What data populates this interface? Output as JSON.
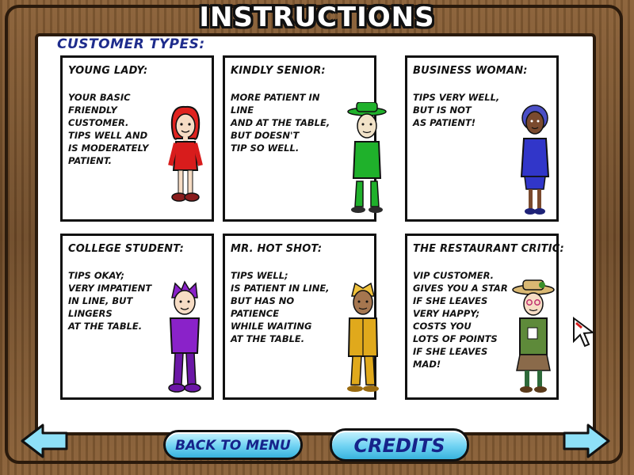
{
  "header": {
    "title": "INSTRUCTIONS"
  },
  "section": {
    "heading": "CUSTOMER TYPES:"
  },
  "customers": [
    {
      "title": "YOUNG LADY:",
      "description": "YOUR BASIC FRIENDLY\nCUSTOMER.\nTIPS WELL AND\nIS MODERATELY\nPATIENT.",
      "color": "#d81c1c"
    },
    {
      "title": "KINDLY SENIOR:",
      "description": "MORE PATIENT IN LINE\nAND AT THE TABLE,\nBUT DOESN'T\nTIP SO WELL.",
      "color": "#1fb12b"
    },
    {
      "title": "BUSINESS WOMAN:",
      "description": "TIPS VERY WELL,\nBUT IS NOT\nAS PATIENT!",
      "color": "#3136c9"
    },
    {
      "title": "COLLEGE STUDENT:",
      "description": "TIPS OKAY;\nVERY IMPATIENT\nIN LINE, BUT\nLINGERS\nAT THE TABLE.",
      "color": "#8a22c9"
    },
    {
      "title": "MR. HOT SHOT:",
      "description": "TIPS WELL;\nIS PATIENT IN LINE,\nBUT HAS NO PATIENCE\nWHILE WAITING\nAT THE TABLE.",
      "color": "#e0a91c"
    },
    {
      "title": "THE RESTAURANT CRITIC:",
      "description": "VIP CUSTOMER.\nGIVES YOU A STAR\nIF SHE LEAVES\nVERY HAPPY;\nCOSTS YOU\nLOTS OF POINTS\nIF SHE LEAVES MAD!",
      "color": "#5e8a3a"
    }
  ],
  "footer": {
    "back_label": "BACK TO MENU",
    "credits_label": "CREDITS"
  },
  "icons": {
    "prev": "left-arrow-icon",
    "next": "right-arrow-icon",
    "cursor": "mouse-cursor-icon"
  }
}
